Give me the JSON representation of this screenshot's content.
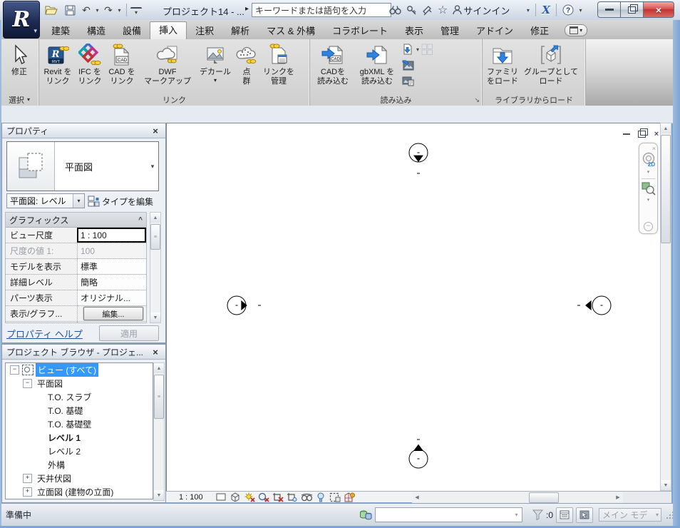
{
  "titlebar": {
    "title": "プロジェクト14 - ...",
    "search_text": "キーワードまたは語句を入力",
    "signin": "サインイン",
    "exchange": "X",
    "help": "?"
  },
  "tabs": [
    "建築",
    "構造",
    "設備",
    "挿入",
    "注釈",
    "解析",
    "マス & 外構",
    "コラボレート",
    "表示",
    "管理",
    "アドイン",
    "修正"
  ],
  "active_tab": "挿入",
  "ribbon": {
    "modify_label": "修正",
    "select_label": "選択",
    "link": {
      "label": "リンク",
      "buttons": [
        [
          "Revit を",
          "リンク"
        ],
        [
          "IFC を",
          "リンク"
        ],
        [
          "CAD を",
          "リンク"
        ],
        [
          "DWF",
          "マークアップ"
        ],
        [
          "デカール",
          ""
        ],
        [
          "点",
          "群"
        ],
        [
          "リンクを",
          "管理"
        ]
      ]
    },
    "import": {
      "label": "読み込み",
      "buttons": [
        [
          "CADを",
          "読み込む"
        ],
        [
          "gbXML を",
          "読み込む"
        ]
      ]
    },
    "library": {
      "label": "ライブラリからロード",
      "buttons": [
        [
          "ファミリ",
          "をロード"
        ],
        [
          "グループとして",
          "ロード"
        ]
      ]
    }
  },
  "properties": {
    "title": "プロパティ",
    "type_name": "平面図",
    "instance_name": "平面図: レベル",
    "edit_type": "タイプを編集",
    "section": "グラフィックス",
    "rows": [
      [
        "ビュー尺度",
        "1 : 100"
      ],
      [
        "尺度の値    1:",
        "100"
      ],
      [
        "モデルを表示",
        "標準"
      ],
      [
        "詳細レベル",
        "簡略"
      ],
      [
        "パーツ表示",
        "オリジナル..."
      ],
      [
        "表示/グラフ...",
        "編集..."
      ]
    ],
    "help": "プロパティ ヘルプ",
    "apply": "適用"
  },
  "browser": {
    "title": "プロジェクト ブラウザ - プロジェ...",
    "items": [
      "ビュー (すべて)",
      "平面図",
      "T.O. スラブ",
      "T.O. 基礎",
      "T.O. 基礎壁",
      "レベル 1",
      "レベル 2",
      "外構",
      "天井伏図",
      "立面図 (建物の立面)"
    ]
  },
  "viewbar": {
    "scale": "1 : 100"
  },
  "statusbar": {
    "ready": "準備中",
    "filter_count": ":0",
    "design_option": "メイン モデ"
  },
  "nav": {
    "wheel_label": "2D"
  },
  "glyphs": {
    "caret_down": "▾",
    "caret_right": "▸",
    "scroll_up": "▲",
    "scroll_down": "▼",
    "scroll_left": "◀",
    "scroll_right": "▶",
    "plus": "+",
    "minus": "−",
    "close": "×",
    "collapse": "^",
    "launcher": "↘",
    "star": "☆",
    "undo": "↶",
    "redo": "↷",
    "app_r": "R"
  },
  "colors": {
    "selection_blue": "#3399ff",
    "accent_blue": "#2f83e0",
    "close_red": "#bf3434",
    "link_gold": "#e6b800"
  }
}
